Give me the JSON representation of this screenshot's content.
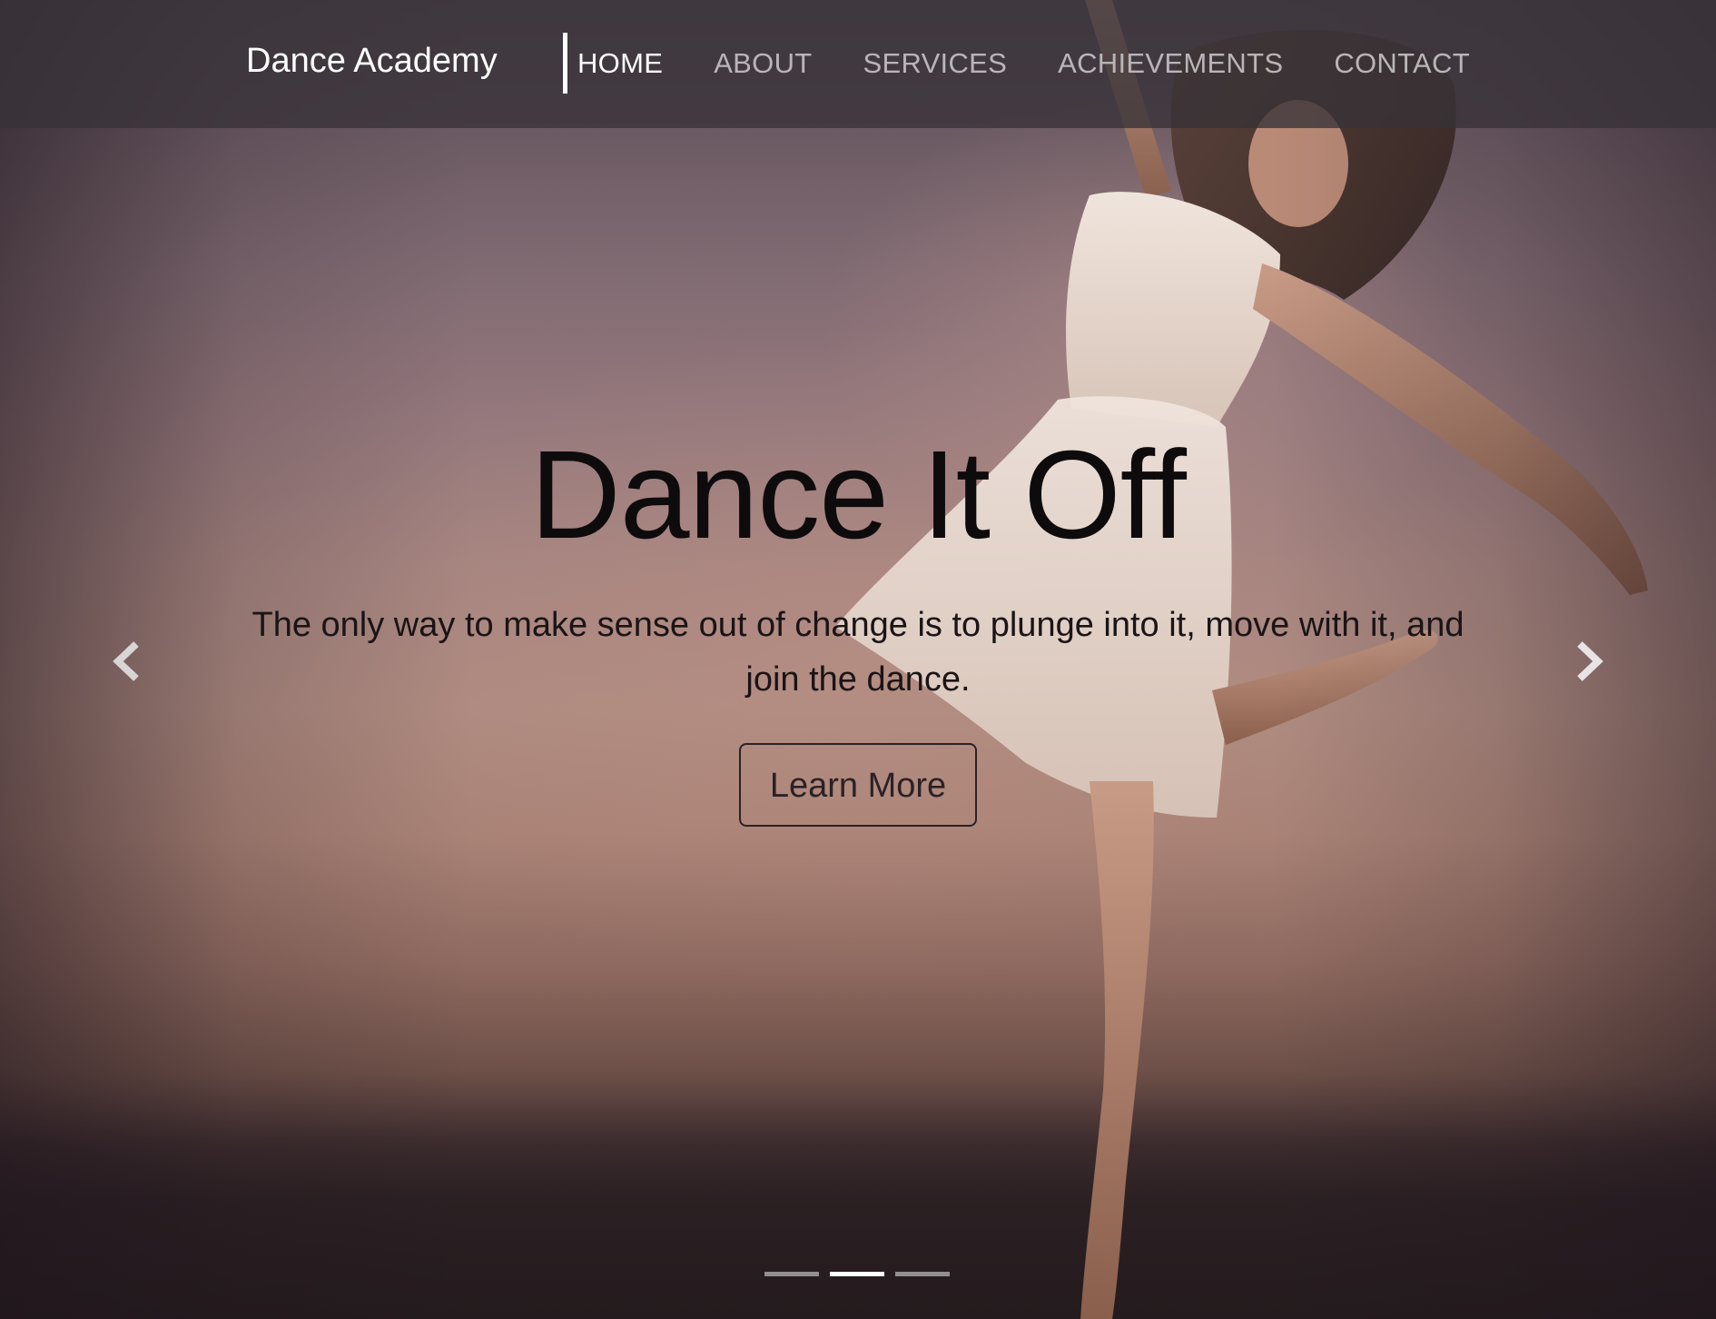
{
  "navbar": {
    "brand": "Dance Academy",
    "items": [
      {
        "label": "HOME",
        "active": true
      },
      {
        "label": "ABOUT",
        "active": false
      },
      {
        "label": "SERVICES",
        "active": false
      },
      {
        "label": "ACHIEVEMENTS",
        "active": false
      },
      {
        "label": "CONTACT",
        "active": false
      }
    ]
  },
  "hero": {
    "headline": "Dance It Off",
    "tagline": "The only way to make sense out of change is to plunge into it, move with it, and join the dance.",
    "cta_label": "Learn More",
    "prev_icon": "chevron-left-icon",
    "next_icon": "chevron-right-icon",
    "slides_total": 3,
    "active_slide": 2
  },
  "colors": {
    "navbar_bg": "#37323a",
    "nav_active": "#ffffff",
    "nav_inactive": "#b9b5b8",
    "headline": "#0e0b0c"
  }
}
